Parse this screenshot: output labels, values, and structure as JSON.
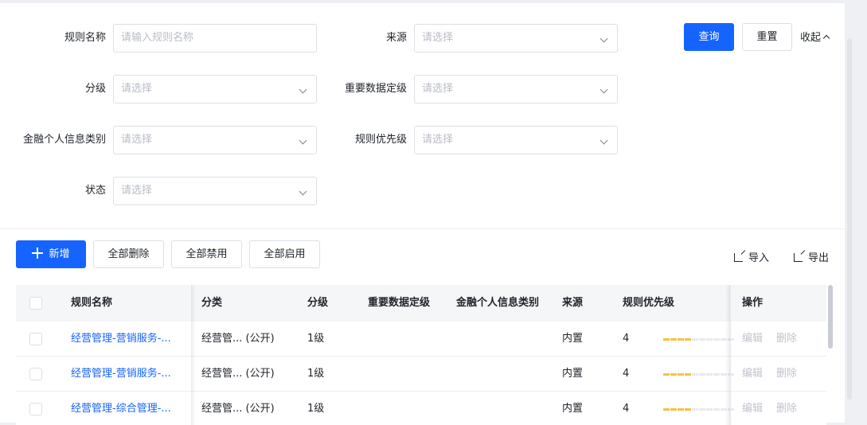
{
  "filters": {
    "rule_name": {
      "label": "规则名称",
      "placeholder": "请输入规则名称"
    },
    "source": {
      "label": "来源",
      "placeholder": "请选择"
    },
    "level": {
      "label": "分级",
      "placeholder": "请选择"
    },
    "important_level": {
      "label": "重要数据定级",
      "placeholder": "请选择"
    },
    "finance_category": {
      "label": "金融个人信息类别",
      "placeholder": "请选择"
    },
    "rule_priority": {
      "label": "规则优先级",
      "placeholder": "请选择"
    },
    "status": {
      "label": "状态",
      "placeholder": "请选择"
    }
  },
  "filter_actions": {
    "query": "查询",
    "reset": "重置",
    "collapse": "收起"
  },
  "toolbar": {
    "add": "新增",
    "delete_all": "全部删除",
    "disable_all": "全部禁用",
    "enable_all": "全部启用",
    "import": "导入",
    "export": "导出"
  },
  "table": {
    "columns": [
      "规则名称",
      "分类",
      "分级",
      "重要数据定级",
      "金融个人信息类别",
      "来源",
      "规则优先级",
      "操作"
    ],
    "rows": [
      {
        "name": "经营管理-营销服务-...",
        "category": "经营管... (公开)",
        "level": "1级",
        "important": "",
        "finance": "",
        "source": "内置",
        "priority": 4,
        "edit": "编辑",
        "delete": "删除"
      },
      {
        "name": "经营管理-营销服务-...",
        "category": "经营管... (公开)",
        "level": "1级",
        "important": "",
        "finance": "",
        "source": "内置",
        "priority": 4,
        "edit": "编辑",
        "delete": "删除"
      },
      {
        "name": "经营管理-综合管理-...",
        "category": "经营管... (公开)",
        "level": "1级",
        "important": "",
        "finance": "",
        "source": "内置",
        "priority": 4,
        "edit": "编辑",
        "delete": "删除"
      }
    ],
    "priority_max": 10
  },
  "colors": {
    "primary": "#1664ff",
    "priority_on": "#f5c243",
    "priority_off": "#e8eaee"
  }
}
